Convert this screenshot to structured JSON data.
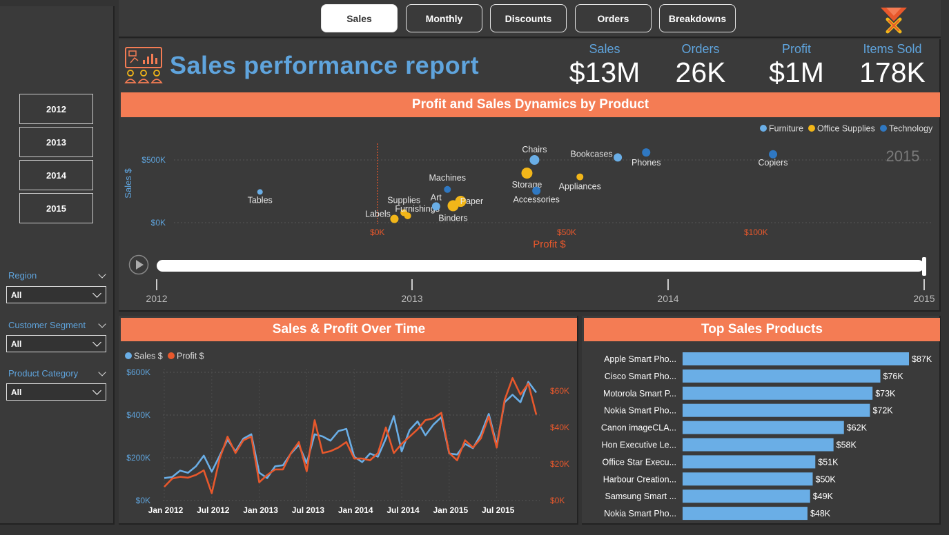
{
  "nav": {
    "tabs": [
      {
        "label": "Sales",
        "active": true
      },
      {
        "label": "Monthly",
        "active": false
      },
      {
        "label": "Discounts",
        "active": false
      },
      {
        "label": "Orders",
        "active": false
      },
      {
        "label": "Breakdowns",
        "active": false
      }
    ]
  },
  "sidebar": {
    "years": [
      "2012",
      "2013",
      "2014",
      "2015"
    ],
    "filters": [
      {
        "label": "Region",
        "value": "All"
      },
      {
        "label": "Customer Segment",
        "value": "All"
      },
      {
        "label": "Product Category",
        "value": "All"
      }
    ]
  },
  "header": {
    "title": "Sales performance report",
    "kpis": [
      {
        "label": "Sales",
        "value": "$13M"
      },
      {
        "label": "Orders",
        "value": "26K"
      },
      {
        "label": "Profit",
        "value": "$1M"
      },
      {
        "label": "Items Sold",
        "value": "178K"
      }
    ]
  },
  "colors": {
    "accent": "#f47c54",
    "blue": "#5fa4dd",
    "furniture": "#6aaee6",
    "office_supplies": "#f2b619",
    "technology": "#2f78c2",
    "profit_line": "#e8582c",
    "background": "#333333",
    "panel": "#3a3a3a"
  },
  "scatter_section": {
    "title": "Profit and Sales Dynamics by Product"
  },
  "line_section": {
    "title": "Sales & Profit Over Time"
  },
  "bar_section": {
    "title": "Top Sales Products"
  },
  "play_axis": {
    "ticks": [
      "2012",
      "2013",
      "2014",
      "2015"
    ],
    "current": "2015"
  },
  "chart_data": [
    {
      "type": "scatter",
      "title": "Profit and Sales Dynamics by Product",
      "xlabel": "Profit $",
      "ylabel": "Sales $",
      "watermark": "2015",
      "x_ticks": [
        {
          "value": 0,
          "label": "$0K"
        },
        {
          "value": 50000,
          "label": "$50K"
        },
        {
          "value": 100000,
          "label": "$100K"
        }
      ],
      "y_ticks": [
        {
          "value": 0,
          "label": "$0K"
        },
        {
          "value": 500000,
          "label": "$500K"
        }
      ],
      "xlim": [
        -51000,
        124000
      ],
      "ylim": [
        0,
        520000
      ],
      "legend": [
        {
          "name": "Furniture",
          "color": "#6aaee6"
        },
        {
          "name": "Office Supplies",
          "color": "#f2b619"
        },
        {
          "name": "Technology",
          "color": "#2f78c2"
        }
      ],
      "points": [
        {
          "label": "Tables",
          "category": "Furniture",
          "x": -31000,
          "y": 245000,
          "size": 4
        },
        {
          "label": "Labels",
          "category": "Office Supplies",
          "x": 4500,
          "y": 30000,
          "size": 6
        },
        {
          "label": "Supplies",
          "category": "Office Supplies",
          "x": 7000,
          "y": 80000,
          "size": 5
        },
        {
          "label": "Furnishings",
          "category": "Office Supplies",
          "x": 8000,
          "y": 55000,
          "size": 5
        },
        {
          "label": "Machines",
          "category": "Technology",
          "x": 18500,
          "y": 265000,
          "size": 5
        },
        {
          "label": "Art",
          "category": "Furniture",
          "x": 15500,
          "y": 130000,
          "size": 6
        },
        {
          "label": "Paper",
          "category": "Office Supplies",
          "x": 22000,
          "y": 170000,
          "size": 8
        },
        {
          "label": "Binders",
          "category": "Office Supplies",
          "x": 20000,
          "y": 135000,
          "size": 8
        },
        {
          "label": "Chairs",
          "category": "Furniture",
          "x": 41500,
          "y": 500000,
          "size": 7
        },
        {
          "label": "Storage",
          "category": "Office Supplies",
          "x": 39500,
          "y": 395000,
          "size": 8
        },
        {
          "label": "Accessories",
          "category": "Technology",
          "x": 42000,
          "y": 255000,
          "size": 6
        },
        {
          "label": "Appliances",
          "category": "Office Supplies",
          "x": 53500,
          "y": 365000,
          "size": 5
        },
        {
          "label": "Bookcases",
          "category": "Furniture",
          "x": 63500,
          "y": 520000,
          "size": 6
        },
        {
          "label": "Phones",
          "category": "Technology",
          "x": 71000,
          "y": 560000,
          "size": 6
        },
        {
          "label": "Copiers",
          "category": "Technology",
          "x": 104500,
          "y": 545000,
          "size": 6
        }
      ]
    },
    {
      "type": "line",
      "title": "Sales & Profit Over Time",
      "legend": [
        "Sales $",
        "Profit $"
      ],
      "x_ticks": [
        "Jan 2012",
        "Jul 2012",
        "Jan 2013",
        "Jul 2013",
        "Jan 2014",
        "Jul 2014",
        "Jan 2015",
        "Jul 2015"
      ],
      "y_left_ticks": [
        "$0K",
        "$200K",
        "$400K",
        "$600K"
      ],
      "y_right_ticks": [
        "$0K",
        "$20K",
        "$40K",
        "$60K"
      ],
      "ylim_left": [
        0,
        600000
      ],
      "ylim_right": [
        0,
        60000
      ],
      "series": [
        {
          "name": "Sales $",
          "axis": "left",
          "values": [
            105000,
            110000,
            140000,
            130000,
            160000,
            210000,
            135000,
            210000,
            285000,
            230000,
            290000,
            310000,
            130000,
            105000,
            160000,
            165000,
            220000,
            260000,
            175000,
            310000,
            300000,
            280000,
            325000,
            335000,
            205000,
            180000,
            220000,
            205000,
            290000,
            395000,
            230000,
            330000,
            370000,
            305000,
            355000,
            390000,
            220000,
            215000,
            265000,
            245000,
            310000,
            405000,
            260000,
            460000,
            495000,
            460000,
            555000,
            505000
          ]
        },
        {
          "name": "Profit $",
          "axis": "right",
          "values": [
            7500,
            12000,
            13000,
            12500,
            14000,
            16500,
            4000,
            23000,
            35000,
            26000,
            33000,
            35000,
            10000,
            14000,
            17000,
            17000,
            26000,
            32000,
            16000,
            44000,
            26000,
            27000,
            29000,
            32000,
            23000,
            23000,
            22000,
            26000,
            40000,
            26000,
            31000,
            35000,
            39000,
            44000,
            45000,
            48000,
            26000,
            22000,
            33000,
            29000,
            34000,
            46000,
            29000,
            55000,
            67000,
            58000,
            64000,
            47000
          ]
        }
      ]
    },
    {
      "type": "bar",
      "title": "Top Sales Products",
      "orientation": "horizontal",
      "categories": [
        "Apple Smart Pho...",
        "Cisco Smart Pho...",
        "Motorola Smart P...",
        "Nokia Smart Pho...",
        "Canon imageCLA...",
        "Hon Executive Le...",
        "Office Star Execu...",
        "Harbour Creation...",
        "Samsung Smart ...",
        "Nokia Smart Pho..."
      ],
      "values": [
        87000,
        76000,
        73000,
        72000,
        62000,
        58000,
        51000,
        50000,
        49000,
        48000
      ],
      "labels": [
        "$87K",
        "$76K",
        "$73K",
        "$72K",
        "$62K",
        "$58K",
        "$51K",
        "$50K",
        "$49K",
        "$48K"
      ],
      "xlim": [
        0,
        90000
      ],
      "color": "#6aaee6"
    }
  ]
}
